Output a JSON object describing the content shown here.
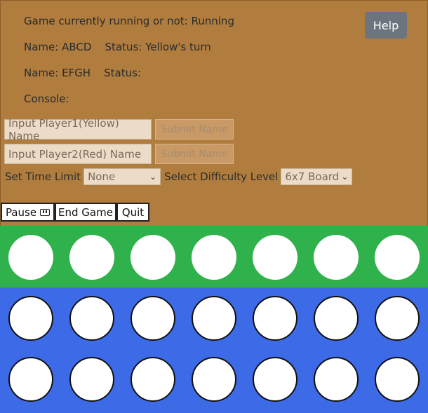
{
  "status": {
    "game_running_label": "Game currently running or not: Running",
    "player1_line": "Name: ABCD    Status: Yellow's turn",
    "player2_line": "Name: EFGH    Status:",
    "console_label": "Console:"
  },
  "help_button": "Help",
  "inputs": {
    "player1_placeholder": "Input Player1(Yellow) Name",
    "player2_placeholder": "Input Player2(Red) Name",
    "submit_label": "Submit Name"
  },
  "settings": {
    "time_limit_label": "Set Time Limit",
    "time_limit_value": "None",
    "difficulty_label": "Select Difficulty Level",
    "difficulty_value": "6x7 Board"
  },
  "controls": {
    "pause": "Pause",
    "end_game": "End Game",
    "quit": "Quit"
  },
  "board": {
    "columns": 7,
    "drop_row_color": "#2fb14b",
    "board_color": "#3d6be8",
    "rows_visible": 2
  }
}
